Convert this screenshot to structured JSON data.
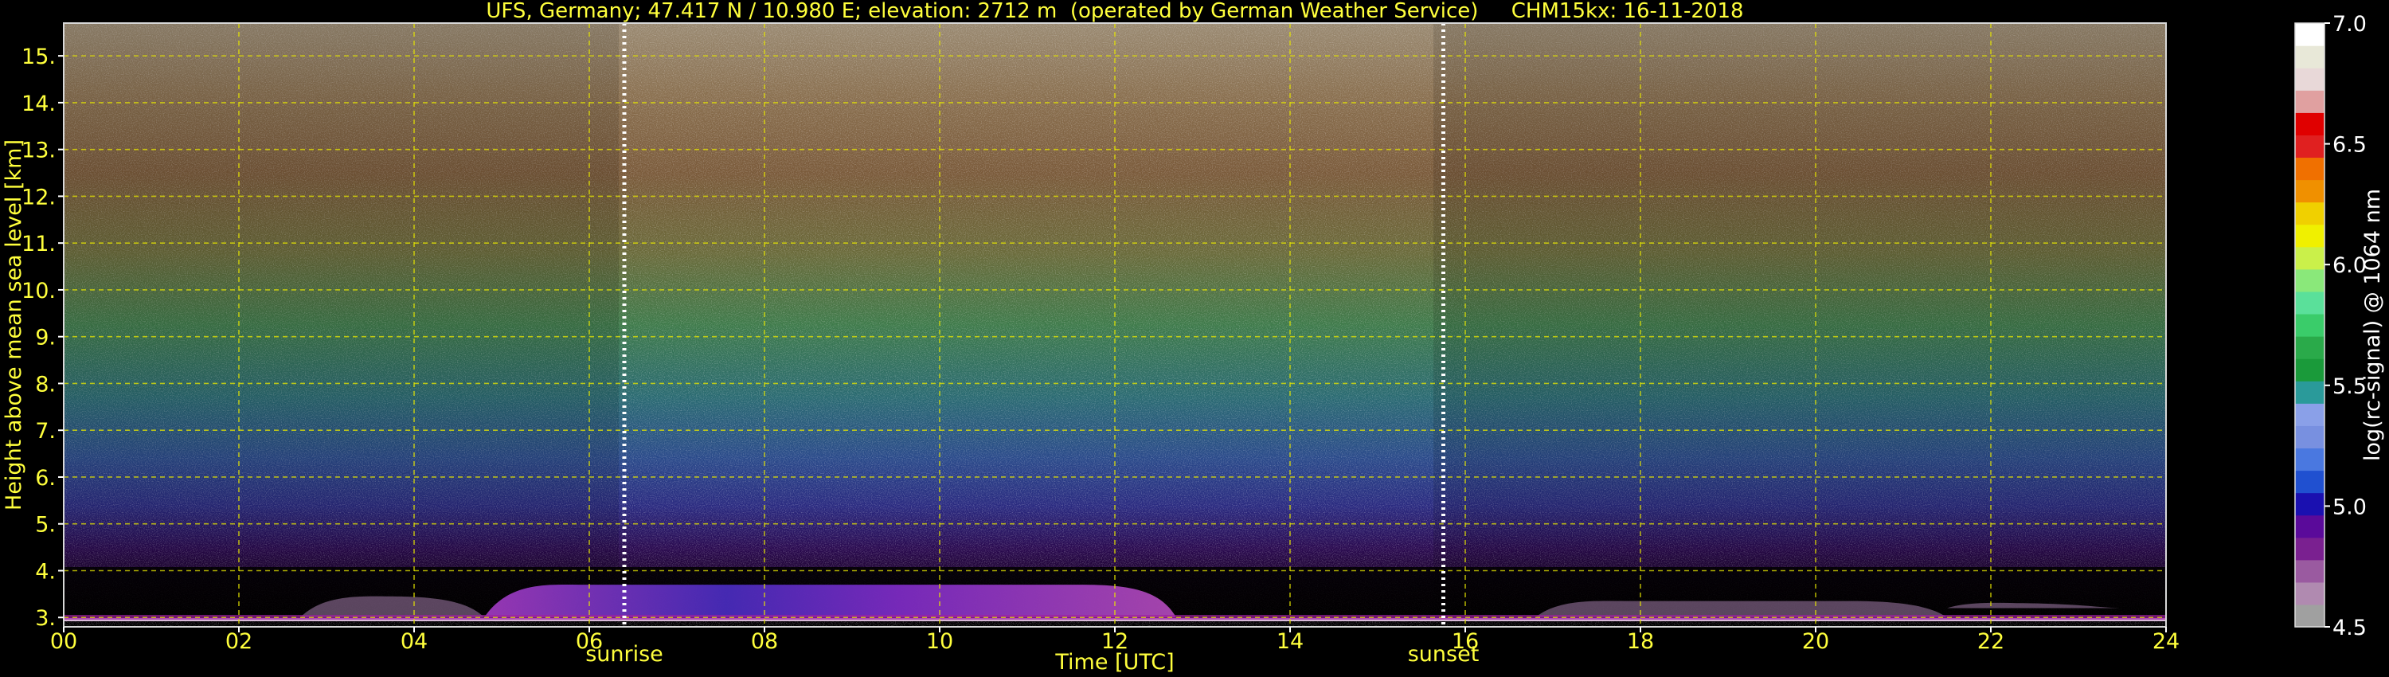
{
  "chart_data": {
    "type": "heatmap",
    "title": "UFS, Germany; 47.417 N / 10.980 E; elevation: 2712 m  (operated by German Weather Service)     CHM15kx: 16-11-2018",
    "xlabel": "Time [UTC]",
    "ylabel": "Height above mean sea level [km]",
    "xlim": [
      0,
      24
    ],
    "ylim": [
      2.8,
      15.7
    ],
    "x_ticks": [
      "00",
      "02",
      "04",
      "06",
      "08",
      "10",
      "12",
      "14",
      "16",
      "18",
      "20",
      "22",
      "24"
    ],
    "y_ticks": [
      "3.",
      "4.",
      "5.",
      "6.",
      "7.",
      "8.",
      "9.",
      "10.",
      "11.",
      "12.",
      "13.",
      "14.",
      "15."
    ],
    "grid": true,
    "annotations": [
      {
        "label": "sunrise",
        "time": 6.4
      },
      {
        "label": "sunset",
        "time": 15.75
      }
    ],
    "colorbar": {
      "label": "log(rc-signal) @ 1064 nm",
      "range": [
        4.5,
        7.0
      ],
      "ticks": [
        "4.5",
        "5.0",
        "5.5",
        "6.0",
        "6.5",
        "7.0"
      ],
      "colors": [
        "#a0a0a0",
        "#b08ab0",
        "#9a5aa0",
        "#7a2090",
        "#5a0a9a",
        "#1a10b0",
        "#2050d0",
        "#4a78e0",
        "#7890e0",
        "#8aa0e8",
        "#2a9a9a",
        "#1a9a3a",
        "#2aaa4a",
        "#3acc6a",
        "#5ae09a",
        "#8ae87a",
        "#caf04a",
        "#f0f000",
        "#f0d000",
        "#f09000",
        "#f07000",
        "#e02020",
        "#e00000",
        "#e0a0a0",
        "#e8d8d8",
        "#e8e8d8",
        "#ffffff"
      ]
    },
    "layers": [
      {
        "name": "aerosol-layer-day",
        "t_start": 4.8,
        "t_end": 12.7,
        "base_km": 3.0,
        "top_km": 3.7
      },
      {
        "name": "aerosol-layer-morning",
        "t_start": 2.7,
        "t_end": 4.8,
        "base_km": 3.0,
        "top_km": 3.45
      },
      {
        "name": "aerosol-layer-evening",
        "t_start": 16.8,
        "t_end": 21.5,
        "base_km": 3.0,
        "top_km": 3.35
      },
      {
        "name": "aerosol-layer-late",
        "t_start": 21.5,
        "t_end": 23.5,
        "base_km": 3.2,
        "top_km": 3.3
      }
    ]
  }
}
